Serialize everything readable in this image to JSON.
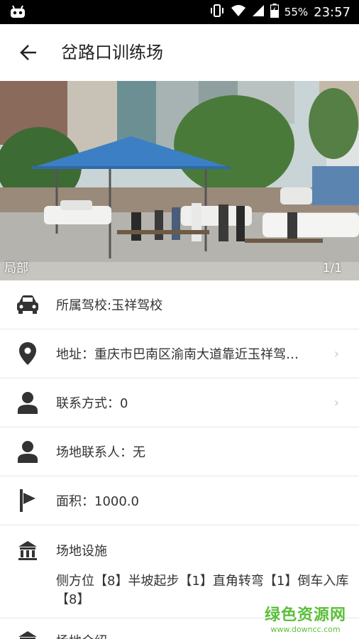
{
  "status_bar": {
    "battery": "55%",
    "time": "23:57"
  },
  "header": {
    "title": "岔路口训练场"
  },
  "hero": {
    "caption": "局部",
    "counter": "1/1"
  },
  "info_rows": [
    {
      "icon": "car-icon",
      "label": "所属驾校:玉祥驾校"
    },
    {
      "icon": "location-pin-icon",
      "label": "地址：重庆市巴南区渝南大道靠近玉祥驾…",
      "chevron": "›"
    },
    {
      "icon": "person-icon",
      "label": "联系方式：0",
      "chevron": "›"
    },
    {
      "icon": "person-icon",
      "label": "场地联系人：无"
    },
    {
      "icon": "area-flag-icon",
      "label": "面积：1000.0"
    },
    {
      "icon": "facility-icon",
      "label": "场地设施"
    },
    {
      "icon": "facility-icon",
      "label": "场地介绍"
    }
  ],
  "facilities": {
    "description": "侧方位【8】半坡起步【1】直角转弯【1】倒车入库【8】"
  },
  "watermark": {
    "main": "绿色资源网",
    "sub": "www.downcc.com"
  }
}
